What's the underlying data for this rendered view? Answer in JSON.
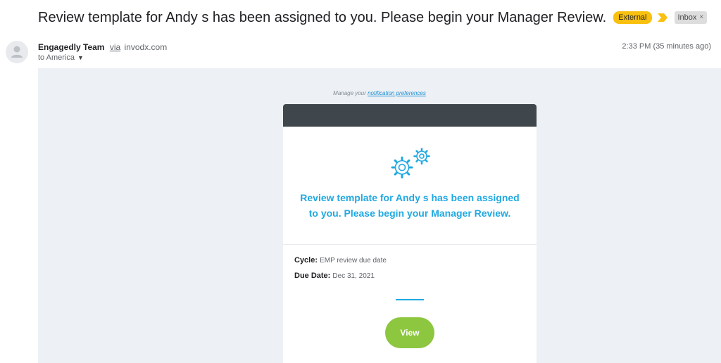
{
  "email": {
    "subject": "Review template for Andy s has been assigned to you. Please begin your Manager Review.",
    "labels": {
      "external": "External",
      "inbox": "Inbox",
      "inbox_remove": "×"
    },
    "sender": {
      "name": "Engagedly Team",
      "via": "via",
      "domain": "invodx.com"
    },
    "recipient": "to America",
    "timestamp": "2:33 PM (35 minutes ago)"
  },
  "body": {
    "manage_prefix": "Manage your",
    "manage_link": "notification preferences",
    "card": {
      "title": "Review template for Andy s has been assigned to you. Please begin your Manager Review.",
      "cycle_label": "Cycle:",
      "cycle_value": "EMP review due date",
      "due_label": "Due Date:",
      "due_value": "Dec 31, 2021",
      "button_label": "View",
      "icon": "gears-icon"
    }
  },
  "colors": {
    "external_label": "#f9c00f",
    "importance_marker": "#f9c00f",
    "card_header": "#40474c",
    "title_blue": "#20a9e1",
    "view_button": "#8dc63f",
    "body_background": "#edf0f4"
  }
}
